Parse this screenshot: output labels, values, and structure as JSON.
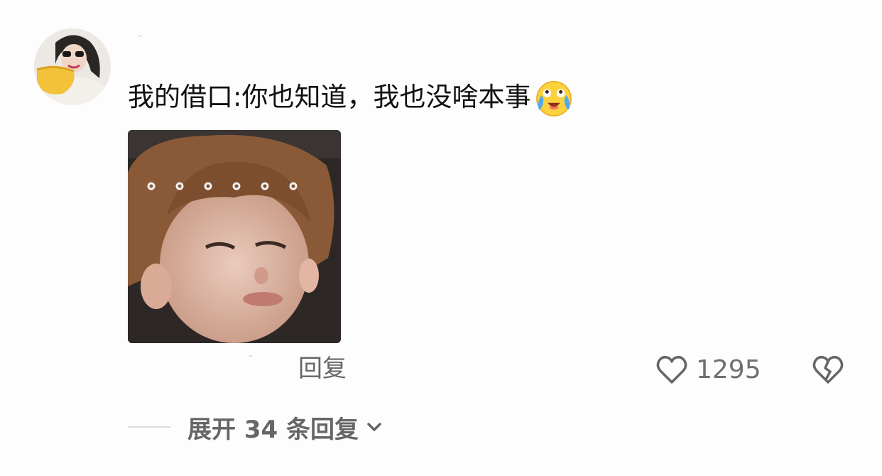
{
  "comment": {
    "text": "我的借口:你也知道，我也没啥本事",
    "emoji_icon": "crying-laughing-face-icon"
  },
  "actions": {
    "reply_label": "回复",
    "like_count": "1295",
    "like_icon": "heart-outline-icon",
    "dislike_icon": "broken-heart-icon"
  },
  "replies": {
    "expand_label": "展开 34 条回复",
    "chevron_icon": "chevron-down-icon"
  },
  "meme": {
    "overlay_text": "。。。。。。"
  },
  "colors": {
    "text_primary": "#111111",
    "text_secondary": "#666666",
    "background": "#fdfdfd"
  }
}
